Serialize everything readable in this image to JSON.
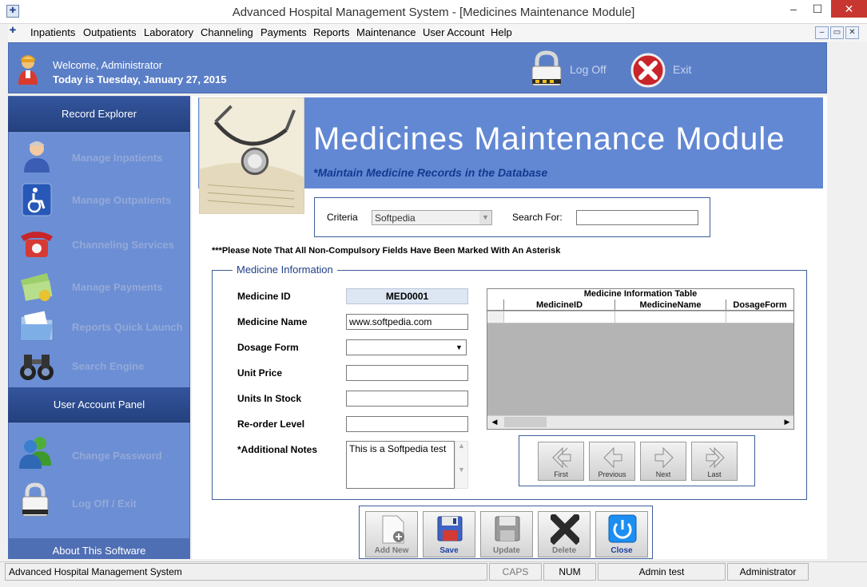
{
  "window": {
    "title": "Advanced Hospital Management System - [Medicines Maintenance Module]",
    "min_glyph": "–",
    "max_glyph": "☐",
    "close_glyph": "✕",
    "app_icon": "hospital-icon"
  },
  "menu": {
    "items": [
      "Inpatients",
      "Outpatients",
      "Laboratory",
      "Channeling",
      "Payments",
      "Reports",
      "Maintenance",
      "User Account",
      "Help"
    ],
    "mdi_min": "–",
    "mdi_restore": "▭",
    "mdi_close": "✕"
  },
  "header": {
    "welcome": "Welcome, Administrator",
    "today": "Today is Tuesday, January 27, 2015",
    "logoff_label": "Log Off",
    "exit_label": "Exit"
  },
  "sidebar": {
    "record_explorer": "Record Explorer",
    "items": [
      {
        "label": "Manage Inpatients",
        "icon": "nurse-icon"
      },
      {
        "label": "Manage Outpatients",
        "icon": "wheelchair-icon"
      },
      {
        "label": "Channeling Services",
        "icon": "telephone-icon"
      },
      {
        "label": "Manage Payments",
        "icon": "money-icon"
      },
      {
        "label": "Reports Quick Launch",
        "icon": "folder-icon"
      },
      {
        "label": "Search Engine",
        "icon": "binoculars-icon"
      }
    ],
    "user_panel": "User Account Panel",
    "user_items": [
      {
        "label": "Change Password",
        "icon": "users-icon"
      },
      {
        "label": "Log Off / Exit",
        "icon": "padlock-icon"
      }
    ],
    "about": "About This Software"
  },
  "module": {
    "title": "Medicines Maintenance Module",
    "subtitle": "*Maintain Medicine Records in the Database"
  },
  "search": {
    "criteria_label": "Criteria",
    "criteria_value": "Softpedia",
    "search_for_label": "Search For:",
    "search_for_value": ""
  },
  "note": "***Please Note That All Non-Compulsory Fields Have Been Marked With An Asterisk",
  "form": {
    "legend": "Medicine Information",
    "medicine_id_label": "Medicine ID",
    "medicine_id_value": "MED0001",
    "medicine_name_label": "Medicine Name",
    "medicine_name_value": "www.softpedia.com",
    "dosage_form_label": "Dosage Form",
    "dosage_form_value": "",
    "unit_price_label": "Unit Price",
    "unit_price_value": "",
    "units_in_stock_label": "Units In Stock",
    "units_in_stock_value": "",
    "reorder_level_label": "Re-order Level",
    "reorder_level_value": "",
    "notes_label": "*Additional Notes",
    "notes_value": "This is a Softpedia test"
  },
  "table": {
    "caption": "Medicine Information Table",
    "columns": [
      "MedicineID",
      "MedicineName",
      "DosageForm"
    ]
  },
  "nav": {
    "first": "First",
    "previous": "Previous",
    "next": "Next",
    "last": "Last"
  },
  "actions": {
    "add_new": "Add New",
    "save": "Save",
    "update": "Update",
    "delete": "Delete",
    "close": "Close"
  },
  "status": {
    "app": "Advanced Hospital Management System",
    "caps": "CAPS",
    "num": "NUM",
    "user": "Admin test",
    "role": "Administrator"
  },
  "colors": {
    "header_blue": "#5b7fc7",
    "sidebar_blue": "#6c8ed4",
    "section_dark": "#24427f",
    "title_close_red": "#c7372f"
  }
}
